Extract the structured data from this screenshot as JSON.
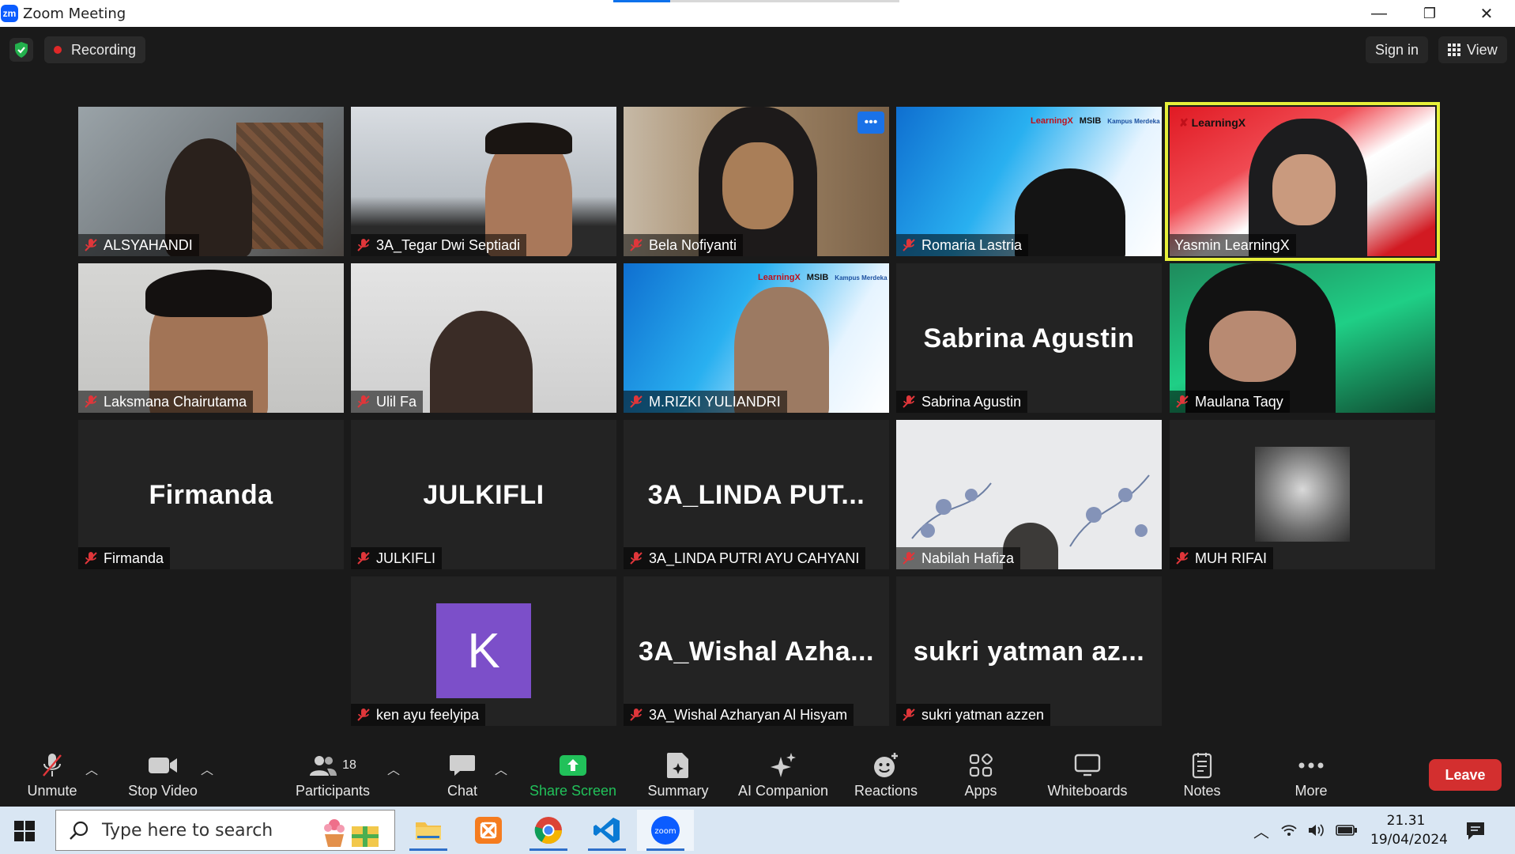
{
  "window": {
    "title": "Zoom Meeting",
    "logo_text": "zm",
    "controls": [
      "—",
      "❐",
      "✕"
    ]
  },
  "topbar": {
    "recording_label": "Recording",
    "signin_label": "Sign in",
    "view_label": "View"
  },
  "participants": [
    {
      "name": "ALSYAHANDI",
      "big": "",
      "video": true
    },
    {
      "name": "3A_Tegar Dwi Septiadi",
      "big": "",
      "video": true
    },
    {
      "name": "Bela Nofiyanti",
      "big": "",
      "video": true
    },
    {
      "name": "Romaria Lastria",
      "big": "",
      "video": true
    },
    {
      "name": "Yasmin LearningX",
      "big": "",
      "video": true,
      "active": true
    },
    {
      "name": "Laksmana Chairutama",
      "big": "",
      "video": true
    },
    {
      "name": "Ulil Fa",
      "big": "",
      "video": true
    },
    {
      "name": "M.RIZKI YULIANDRI",
      "big": "",
      "video": true
    },
    {
      "name": "Sabrina Agustin",
      "big": "Sabrina Agustin",
      "video": false
    },
    {
      "name": "Maulana Taqy",
      "big": "",
      "video": true
    },
    {
      "name": "Firmanda",
      "big": "Firmanda",
      "video": false
    },
    {
      "name": "JULKIFLI",
      "big": "JULKIFLI",
      "video": false
    },
    {
      "name": "3A_LINDA PUTRI AYU CAHYANI",
      "big": "3A_LINDA  PUT...",
      "video": false
    },
    {
      "name": "Nabilah Hafiza",
      "big": "",
      "video": true
    },
    {
      "name": "MUH RIFAI",
      "big": "",
      "video": false
    },
    {
      "name": "ken ayu feelyipa",
      "big": "",
      "video": false,
      "avatar_letter": "K"
    },
    {
      "name": "3A_Wishal Azharyan Al Hisyam",
      "big": "3A_Wishal  Azha...",
      "video": false
    },
    {
      "name": "sukri yatman azzen",
      "big": "sukri  yatman  az...",
      "video": false
    }
  ],
  "brand_text": {
    "learningx": "LearningX",
    "msib": "MSIB",
    "kampus_merdeka": "Kampus Merdeka"
  },
  "toolbar": {
    "unmute": "Unmute",
    "stop_video": "Stop Video",
    "participants": "Participants",
    "participants_count": "18",
    "chat": "Chat",
    "share_screen": "Share Screen",
    "summary": "Summary",
    "ai_companion": "AI Companion",
    "reactions": "Reactions",
    "apps": "Apps",
    "whiteboards": "Whiteboards",
    "notes": "Notes",
    "more": "More",
    "leave": "Leave"
  },
  "taskbar": {
    "search_placeholder": "Type here to search",
    "time": "21.31",
    "date": "19/04/2024"
  },
  "colors": {
    "accent_blue": "#0b5cff",
    "share_green": "#21c15a",
    "leave_red": "#d32f2f",
    "active_speaker": "#e7f03a",
    "mute_red": "#e0363a"
  }
}
